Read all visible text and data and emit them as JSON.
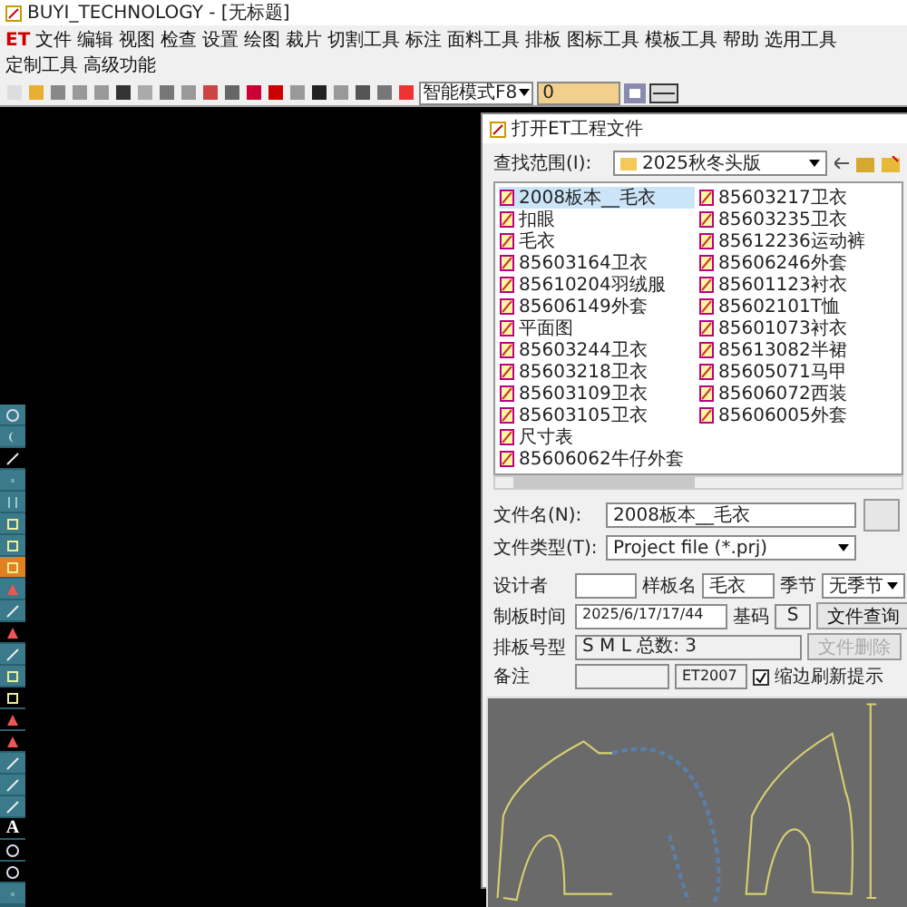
{
  "window": {
    "title": "BUYI_TECHNOLOGY - [无标题]"
  },
  "menu": {
    "logo": "ET",
    "items": [
      "文件",
      "编辑",
      "视图",
      "检查",
      "设置",
      "绘图",
      "裁片",
      "切割工具",
      "标注",
      "面料工具",
      "排板",
      "图标工具",
      "模板工具",
      "帮助",
      "选用工具",
      "定制工具",
      "高级功能"
    ]
  },
  "toolbar": {
    "mode": "智能模式F8",
    "value": "0"
  },
  "side_toolbar": {
    "text_tool": "A"
  },
  "dialog": {
    "title": "打开ET工程文件",
    "look_in_label": "查找范围(I):",
    "look_in": "2025秋冬头版",
    "files": [
      {
        "name": "2008板本__毛衣",
        "selected": true
      },
      {
        "name": "扣眼",
        "selected": false
      },
      {
        "name": "毛衣",
        "selected": false
      },
      {
        "name": "85603164卫衣",
        "selected": false
      },
      {
        "name": "85610204羽绒服",
        "selected": false
      },
      {
        "name": "85606149外套",
        "selected": false
      },
      {
        "name": "平面图",
        "selected": false
      },
      {
        "name": "85603244卫衣",
        "selected": false
      },
      {
        "name": "85603218卫衣",
        "selected": false
      },
      {
        "name": "85603109卫衣",
        "selected": false
      },
      {
        "name": "85603105卫衣",
        "selected": false
      },
      {
        "name": "尺寸表",
        "selected": false
      },
      {
        "name": "85606062牛仔外套",
        "selected": false
      },
      {
        "name": "85603217卫衣",
        "selected": false
      },
      {
        "name": "85603235卫衣",
        "selected": false
      },
      {
        "name": "85612236运动裤",
        "selected": false
      },
      {
        "name": "85606246外套",
        "selected": false
      },
      {
        "name": "85601123衬衣",
        "selected": false
      },
      {
        "name": "85602101T恤",
        "selected": false
      },
      {
        "name": "85601073衬衣",
        "selected": false
      },
      {
        "name": "85613082半裙",
        "selected": false
      },
      {
        "name": "85605071马甲",
        "selected": false
      },
      {
        "name": "85606072西装",
        "selected": false
      },
      {
        "name": "85606005外套",
        "selected": false
      }
    ],
    "file_name_label": "文件名(N):",
    "file_name": "2008板本__毛衣",
    "file_type_label": "文件类型(T):",
    "file_type": "Project file (*.prj)",
    "designer_label": "设计者",
    "pattern_name_label": "样板名",
    "pattern_name": "毛衣",
    "season_label": "季节",
    "season": "无季节",
    "made_time_label": "制板时间",
    "made_time": "2025/6/17/17/44",
    "base_size_label": "基码",
    "base_size": "S",
    "query_button": "文件查询",
    "layout_sizes_label": "排板号型",
    "layout_sizes": "S M L 总数: 3",
    "delete_button": {
      "label": "文件删除",
      "disabled": true
    },
    "notes_label": "备注",
    "version": "ET2007",
    "refresh_prompt": {
      "label": "缩边刷新提示",
      "checked": true
    }
  }
}
